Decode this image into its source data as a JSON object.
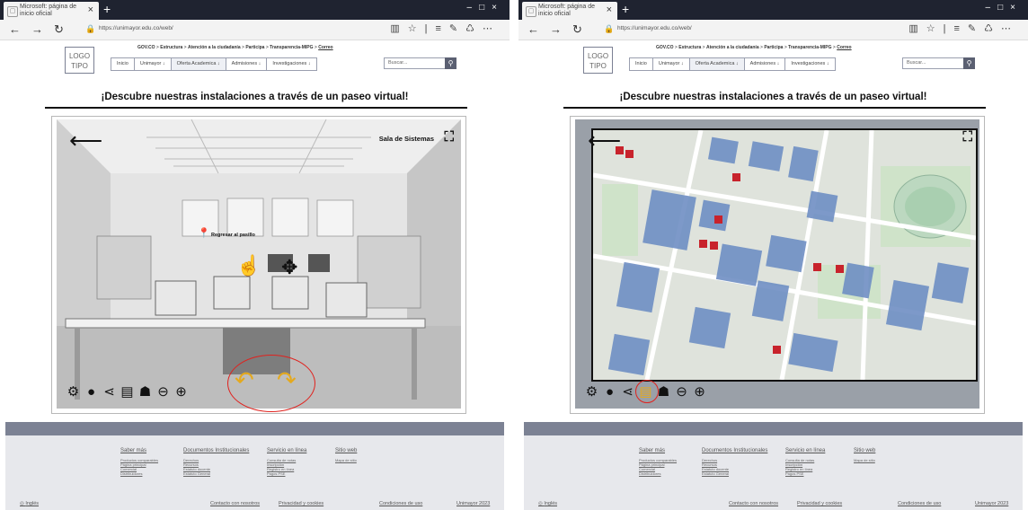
{
  "browser": {
    "tab_title": "Microsoft: página de inicio oficial",
    "url": "https://unimayor.edu.co/web/"
  },
  "site": {
    "logo": "LOGO TIPO",
    "breadcrumb": [
      "GOV.CO",
      "Estructura",
      "Atención a la ciudadanía",
      "Participa",
      "Transparencia-MIPG",
      "Correo"
    ],
    "menu": [
      "Inicio",
      "Unimayor ↓",
      "Oferta Academica ↓",
      "Admisiones ↓",
      "Investigaciones ↓"
    ],
    "search_placeholder": "Buscar...",
    "headline": "¡Descubre nuestras instalaciones a través de un paseo virtual!"
  },
  "viewer_left": {
    "room_label": "Sala de Sistemas",
    "pin_label": "Regresar al pasillo",
    "highlight": "navigation-arrows"
  },
  "viewer_right": {
    "mode": "map",
    "highlight": "map-icon"
  },
  "footer": {
    "columns": [
      {
        "title": "Saber más",
        "items": [
          "Productos comparables",
          "Página principal",
          "Comercial",
          "Distribuidores"
        ]
      },
      {
        "title": "Documentos Institucionales",
        "items": [
          "Derechos",
          "Recursos",
          "Estatuto docente",
          "Estatuto General"
        ]
      },
      {
        "title": "Servicio en línea",
        "items": [
          "Consulta de notas",
          "Inscripción",
          "Registro en línea",
          "Pagos PSE"
        ]
      },
      {
        "title": "Sitio web",
        "items": [
          "Mapa de sitio"
        ]
      }
    ],
    "language": "Inglés",
    "contact": "Contacto con nosotros",
    "privacy": "Privacidad y cookies",
    "terms": "Condiciones de uso",
    "copyright": "Unimayor 2023"
  },
  "colors": {
    "accent_yellow": "#e4a91f",
    "highlight_red": "#e0221e",
    "footer_band": "#7c8294",
    "map_building": "#6f8fc4",
    "map_marker": "#c8232c"
  }
}
